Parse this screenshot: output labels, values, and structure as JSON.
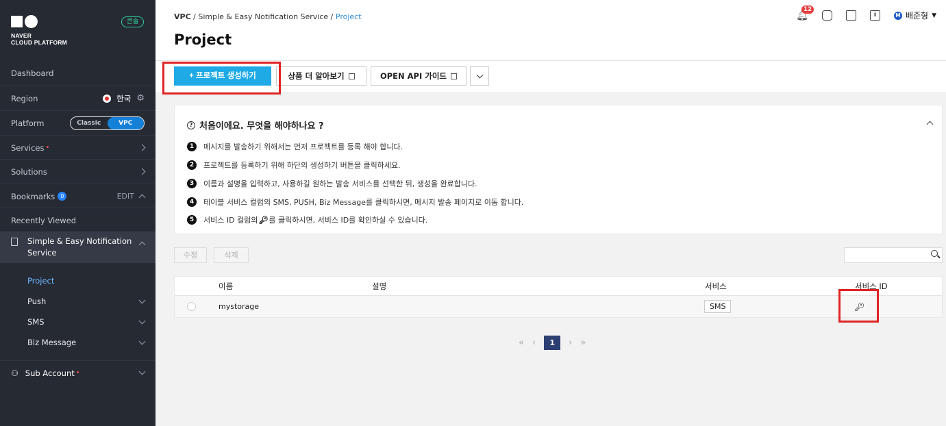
{
  "sidebar": {
    "logo_line1": "NAVER",
    "logo_line2": "CLOUD PLATFORM",
    "console_badge": "콘솔",
    "dashboard": "Dashboard",
    "region_label": "Region",
    "region_value": "한국",
    "platform_label": "Platform",
    "platform_options": [
      "Classic",
      "VPC"
    ],
    "platform_selected": "VPC",
    "services": "Services",
    "solutions": "Solutions",
    "bookmarks": "Bookmarks",
    "bookmarks_count": "0",
    "bookmarks_edit": "EDIT",
    "recently_viewed": "Recently Viewed",
    "active_service_line1": "Simple & Easy Notification",
    "active_service_line2": "Service",
    "sub_items": [
      {
        "label": "Project",
        "active": true
      },
      {
        "label": "Push"
      },
      {
        "label": "SMS"
      },
      {
        "label": "Biz Message"
      }
    ],
    "sub_account": "Sub Account"
  },
  "header": {
    "breadcrumb": [
      "VPC",
      "Simple & Easy Notification Service",
      "Project"
    ],
    "title": "Project",
    "notification_count": "12",
    "user_initial": "M",
    "user_name": "배준형"
  },
  "actions": {
    "create": "+ 프로젝트 생성하기",
    "learn_more": "상품 더 알아보기",
    "api_guide": "OPEN API 가이드"
  },
  "guide": {
    "title": "처음이에요. 무엇을 해야하나요 ?",
    "steps": [
      "메시지를 발송하기 위해서는 먼저 프로젝트를 등록 해야 합니다.",
      "프로젝트를 등록하기 위해 하단의 생성하기 버튼을 클릭하세요.",
      "이름과 설명을 입력하고, 사용하길 원하는 발송 서비스를 선택한 뒤, 생성을 완료합니다.",
      "테이블 서비스 컬럼의 SMS, PUSH, Biz Message를 클릭하시면, 메시지 발송 페이지로 이동 합니다.",
      "서비스 ID 컬럼의",
      "를 클릭하시면, 서비스 ID를 확인하실 수 있습니다."
    ]
  },
  "table_controls": {
    "edit": "수정",
    "delete": "삭제",
    "search_placeholder": ""
  },
  "table": {
    "columns": [
      "이름",
      "설명",
      "서비스",
      "서비스 ID"
    ],
    "rows": [
      {
        "name": "mystorage",
        "description": "",
        "service": "SMS"
      }
    ]
  },
  "pagination": {
    "current": "1"
  },
  "colors": {
    "sidebar_bg": "#262a33",
    "primary": "#1faae6",
    "highlight": "#e02424",
    "page_active": "#2c3f73"
  }
}
